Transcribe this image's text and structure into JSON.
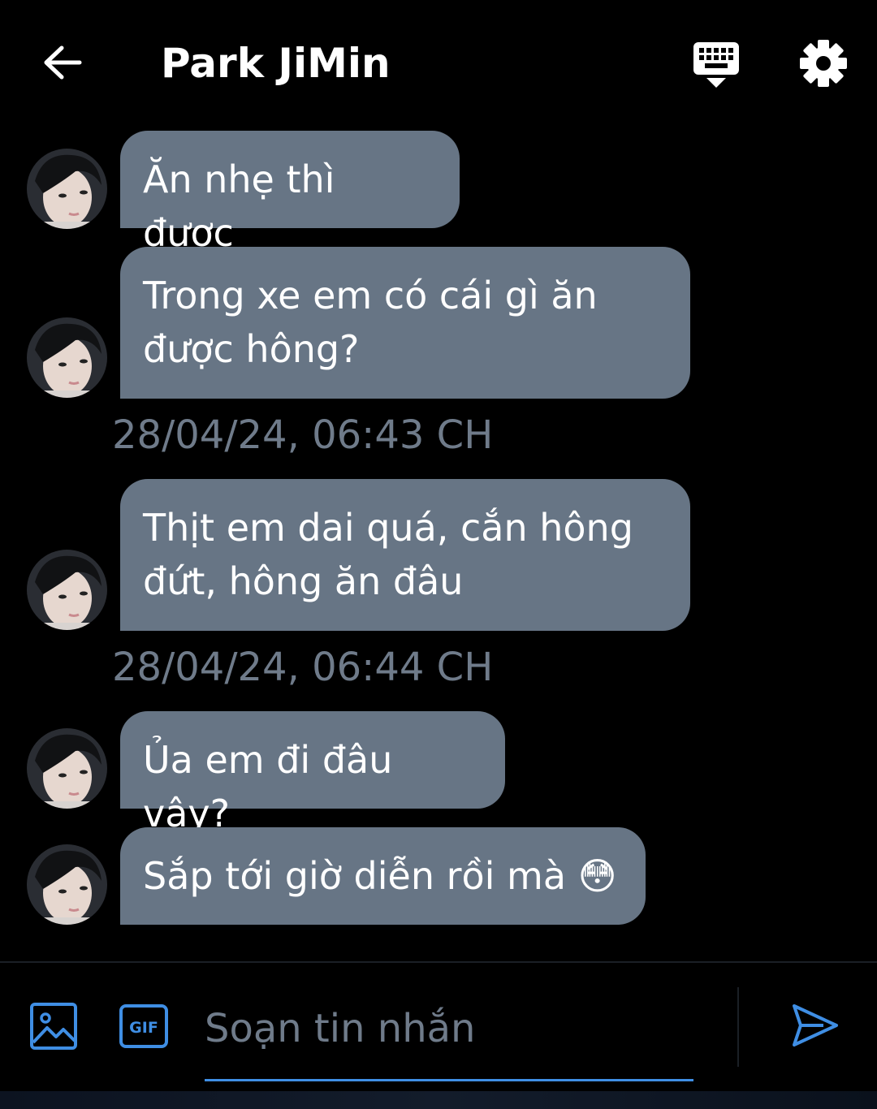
{
  "header": {
    "title": "Park JiMin",
    "back_icon": "arrow-left-icon",
    "keyboard_icon": "keyboard-hide-icon",
    "settings_icon": "gear-icon"
  },
  "messages": [
    {
      "text": "Ăn nhẹ thì được"
    },
    {
      "text": "Trong xe em có cái gì ăn được hông?"
    },
    {
      "text": "Thịt em dai quá, cắn hông đứt, hông ăn đâu"
    },
    {
      "text": "Ủa em đi đâu vậy?"
    },
    {
      "text": "Sắp tới giờ diễn rồi mà 😳"
    }
  ],
  "timestamps": [
    "28/04/24, 06:43 CH",
    "28/04/24, 06:44 CH"
  ],
  "composer": {
    "placeholder": "Soạn tin nhắn",
    "value": "",
    "image_icon": "image-icon",
    "gif_label": "GIF",
    "send_icon": "send-icon"
  },
  "colors": {
    "background": "#000000",
    "bubble": "#677585",
    "timestamp": "#6f7b8a",
    "accent": "#3f8ee4"
  }
}
